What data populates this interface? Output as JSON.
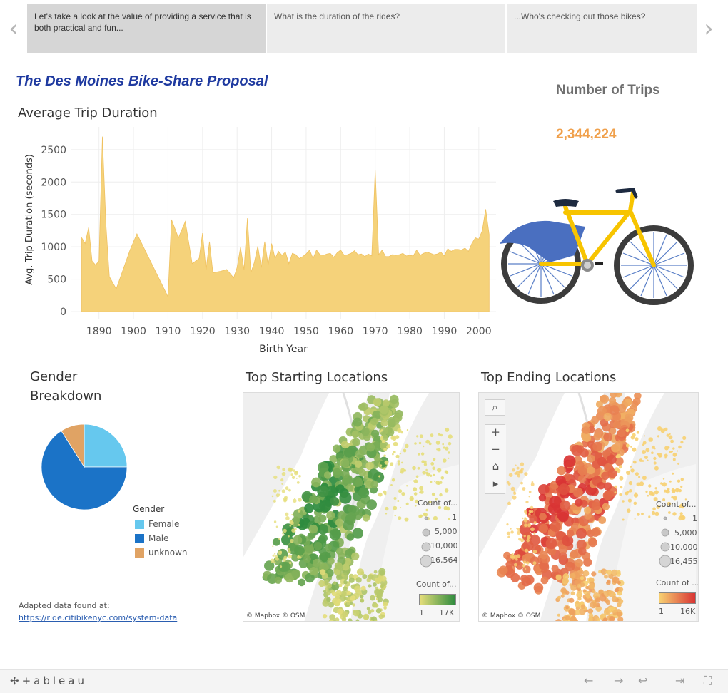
{
  "story": {
    "points": [
      "Let's take a look at the value of providing a service that is both practical and fun...",
      "What is the duration of the rides?",
      "...Who's checking out those bikes?"
    ],
    "prev_arrow": "‹",
    "next_arrow": "›"
  },
  "dashboard": {
    "title": "The Des Moines Bike-Share Proposal"
  },
  "kpi": {
    "label": "Number of Trips",
    "value": "2,344,224",
    "value_color": "#f0a04b"
  },
  "duration_chart": {
    "section_title": "Average Trip Duration",
    "chart_data": {
      "type": "area",
      "title": "Average Trip Duration",
      "xlabel": "Birth Year",
      "ylabel": "Avg. Trip Duration (seconds)",
      "xlim": [
        1882,
        2005
      ],
      "ylim": [
        -120,
        2850
      ],
      "x_ticks": [
        1890,
        1900,
        1910,
        1920,
        1930,
        1940,
        1950,
        1960,
        1970,
        1980,
        1990,
        2000
      ],
      "y_ticks": [
        0,
        500,
        1000,
        1500,
        2000,
        2500
      ],
      "grid": true,
      "color": "#f5d27a",
      "x": [
        1885,
        1886,
        1887,
        1888,
        1889,
        1890,
        1891,
        1892,
        1893,
        1895,
        1899,
        1901,
        1910,
        1911,
        1913,
        1915,
        1917,
        1919,
        1920,
        1921,
        1922,
        1923,
        1925,
        1927,
        1929,
        1930,
        1931,
        1932,
        1933,
        1934,
        1935,
        1936,
        1937,
        1938,
        1939,
        1940,
        1941,
        1942,
        1943,
        1944,
        1945,
        1946,
        1947,
        1948,
        1949,
        1950,
        1951,
        1952,
        1953,
        1954,
        1955,
        1956,
        1957,
        1958,
        1959,
        1960,
        1961,
        1962,
        1963,
        1964,
        1965,
        1966,
        1967,
        1968,
        1969,
        1970,
        1971,
        1972,
        1973,
        1974,
        1975,
        1976,
        1977,
        1978,
        1979,
        1980,
        1981,
        1982,
        1983,
        1984,
        1985,
        1986,
        1987,
        1988,
        1989,
        1990,
        1991,
        1992,
        1993,
        1994,
        1995,
        1996,
        1997,
        1998,
        1999,
        2000,
        2001,
        2002,
        2003
      ],
      "y": [
        1140,
        1050,
        1300,
        780,
        720,
        780,
        2700,
        1350,
        540,
        350,
        950,
        1200,
        230,
        1420,
        1140,
        1390,
        740,
        820,
        1210,
        640,
        1080,
        600,
        620,
        650,
        520,
        680,
        990,
        650,
        1440,
        600,
        760,
        1010,
        680,
        1080,
        720,
        1050,
        820,
        930,
        870,
        920,
        740,
        900,
        880,
        820,
        850,
        890,
        950,
        820,
        950,
        880,
        870,
        890,
        900,
        840,
        910,
        950,
        870,
        880,
        900,
        940,
        880,
        890,
        850,
        890,
        860,
        2180,
        880,
        950,
        850,
        850,
        880,
        870,
        880,
        900,
        860,
        870,
        860,
        950,
        870,
        900,
        920,
        900,
        880,
        890,
        920,
        860,
        970,
        930,
        960,
        960,
        950,
        980,
        930,
        1050,
        1140,
        1120,
        1250,
        1580,
        1190,
        1500,
        1380
      ]
    }
  },
  "gender": {
    "section_title": "Gender Breakdown",
    "chart_data": {
      "type": "pie",
      "title": "Gender Breakdown",
      "legend_title": "Gender",
      "legend_position": "bottom-right",
      "slices": [
        {
          "label": "Female",
          "value": 25,
          "color": "#66c8ee"
        },
        {
          "label": "Male",
          "value": 66,
          "color": "#1b73c7"
        },
        {
          "label": "unknown",
          "value": 9,
          "color": "#e0a364"
        }
      ]
    }
  },
  "footnote": {
    "prefix": "Adapted data found at: ",
    "link": "https://ride.citibikenyc.com/system-data"
  },
  "start_map": {
    "section_title": "Top Starting Locations",
    "size_legend_title": "Count of...",
    "size_legend_values": [
      "1",
      "5,000",
      "10,000",
      "16,564"
    ],
    "color_legend_title": "Count of...",
    "color_min": "1",
    "color_max": "17K",
    "color_low": "#e6de7a",
    "color_high": "#2e8b3e",
    "attribution": "© Mapbox  © OSM"
  },
  "end_map": {
    "section_title": "Top Ending Locations",
    "size_legend_title": "Count of...",
    "size_legend_values": [
      "1",
      "5,000",
      "10,000",
      "16,455"
    ],
    "color_legend_title": "Count of ...",
    "color_min": "1",
    "color_max": "16K",
    "color_low": "#f7d071",
    "color_high": "#d93434",
    "attribution": "© Mapbox  © OSM",
    "tools": {
      "search": "⌕",
      "zoom_in": "+",
      "zoom_out": "−",
      "home": "⌂",
      "play": "▸"
    }
  },
  "toolbar": {
    "logo": "✢+ableau",
    "undo": "←",
    "redo": "→",
    "revert": "⇥",
    "share": "↩",
    "fullscreen": "⛶"
  }
}
